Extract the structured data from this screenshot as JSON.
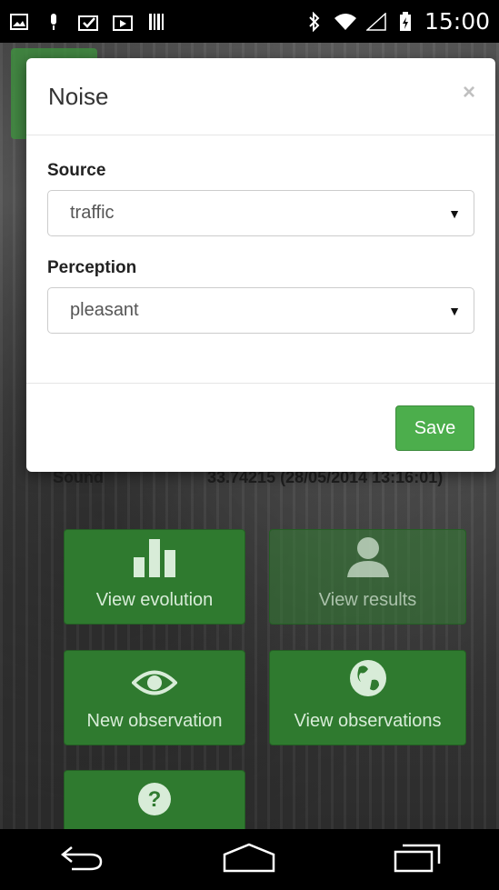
{
  "status_bar": {
    "time": "15:00"
  },
  "modal": {
    "title": "Noise",
    "close_label": "×",
    "source_label": "Source",
    "source_value": "traffic",
    "perception_label": "Perception",
    "perception_value": "pleasant",
    "save_label": "Save"
  },
  "background": {
    "sound_label": "Sound",
    "sound_value": "33.74215 (28/05/2014 13:16:01)",
    "tiles": [
      {
        "label": "View evolution"
      },
      {
        "label": "View results"
      },
      {
        "label": "New observation"
      },
      {
        "label": "View observations"
      }
    ]
  },
  "icons": {
    "bar_chart": "bar-chart-icon",
    "user": "user-icon",
    "eye": "eye-icon",
    "globe": "globe-icon",
    "help": "help-icon"
  },
  "colors": {
    "accent_green": "#4cae4c",
    "tile_green": "#2f7a2f"
  }
}
